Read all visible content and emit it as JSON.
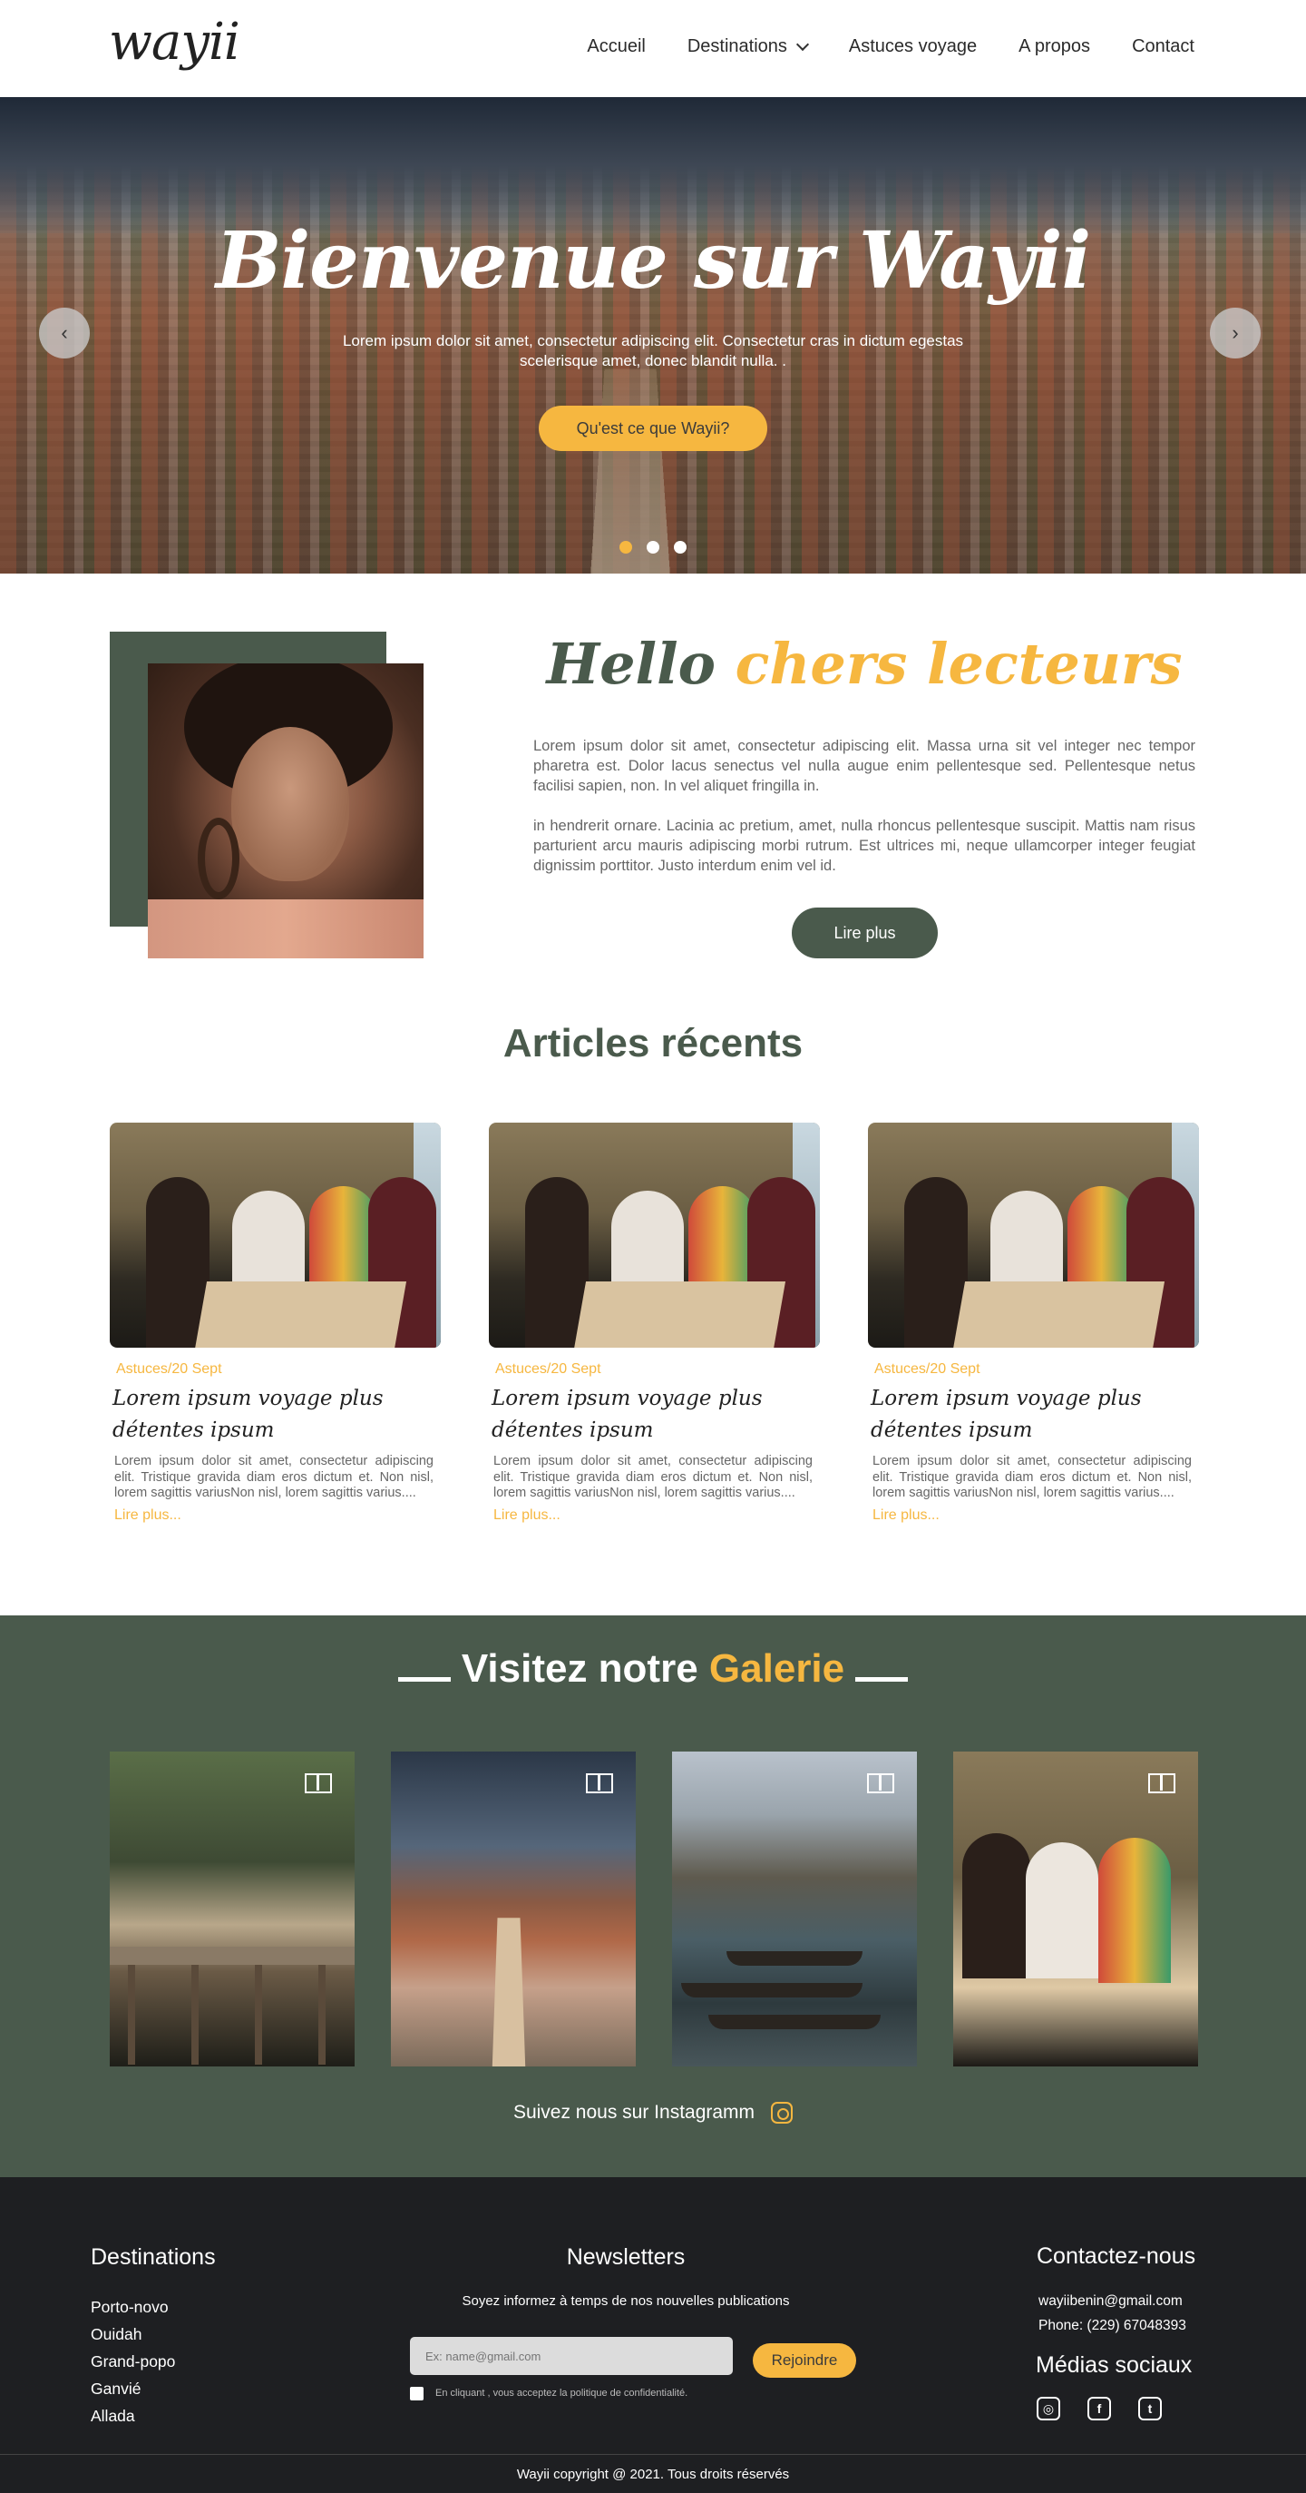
{
  "header": {
    "logo": "wayii",
    "nav": [
      "Accueil",
      "Destinations",
      "Astuces voyage",
      "A propos",
      "Contact"
    ]
  },
  "hero": {
    "title": "Bienvenue sur Wayii",
    "text": "Lorem ipsum dolor sit amet, consectetur adipiscing elit. Consectetur cras in dictum egestas scelerisque amet, donec blandit nulla. .",
    "button": "Qu'est ce que  Wayii?",
    "prev_icon": "chevron-left-icon",
    "next_icon": "chevron-right-icon"
  },
  "hello": {
    "title_a": "Hello",
    "title_b": "chers lecteurs",
    "p1": "Lorem ipsum dolor sit amet, consectetur adipiscing elit. Massa urna sit vel integer nec tempor pharetra est. Dolor lacus senectus vel nulla augue enim pellentesque sed. Pellentesque netus facilisi sapien, non. In vel aliquet fringilla in.",
    "p2": "in hendrerit ornare. Lacinia ac pretium, amet, nulla rhoncus pellentesque suscipit. Mattis nam risus parturient arcu mauris adipiscing morbi rutrum. Est ultrices mi, neque ullamcorper integer feugiat dignissim porttitor. Justo interdum enim vel id.",
    "button": "Lire plus"
  },
  "articles": {
    "title": "Articles récents",
    "items": [
      {
        "meta": "Astuces/20 Sept",
        "title": "Lorem ipsum voyage plus détentes ipsum",
        "text": "Lorem ipsum dolor sit amet, consectetur adipiscing elit. Tristique gravida diam eros dictum et. Non nisl, lorem sagittis variusNon nisl, lorem sagittis varius....",
        "link": "Lire  plus..."
      },
      {
        "meta": "Astuces/20 Sept",
        "title": "Lorem ipsum voyage plus détentes ipsum",
        "text": "Lorem ipsum dolor sit amet, consectetur adipiscing elit. Tristique gravida diam eros dictum et. Non nisl, lorem sagittis variusNon nisl, lorem sagittis varius....",
        "link": "Lire  plus..."
      },
      {
        "meta": "Astuces/20 Sept",
        "title": "Lorem ipsum voyage plus détentes ipsum",
        "text": "Lorem ipsum dolor sit amet, consectetur adipiscing elit. Tristique gravida diam eros dictum et. Non nisl, lorem sagittis variusNon nisl, lorem sagittis varius....",
        "link": "Lire  plus..."
      }
    ]
  },
  "gallery": {
    "title_a": "Visitez notre",
    "title_b": "Galerie",
    "instagram": "Suivez nous sur Instagramm"
  },
  "footer": {
    "destinations_title": "Destinations",
    "destinations": [
      "Porto-novo",
      "Ouidah",
      "Grand-popo",
      "Ganvié",
      "Allada"
    ],
    "newsletter_title": "Newsletters",
    "newsletter_sub": "Soyez informez à temps de nos nouvelles publications",
    "newsletter_placeholder": "Ex: name@gmail.com",
    "newsletter_button": "Rejoindre",
    "newsletter_policy": "En cliquant , vous acceptez la politique de confidentialité.",
    "contact_title": "Contactez-nous",
    "email": "wayiibenin@gmail.com",
    "phone": "Phone: (229) 67048393",
    "social_title": "Médias sociaux",
    "social_icons": [
      "instagram-icon",
      "facebook-icon",
      "twitter-icon"
    ],
    "copyright": "Wayii copyright @ 2021. Tous droits réservés"
  },
  "colors": {
    "accent": "#f6b740",
    "green": "#4a5a4c",
    "footer": "#1e1f22"
  }
}
